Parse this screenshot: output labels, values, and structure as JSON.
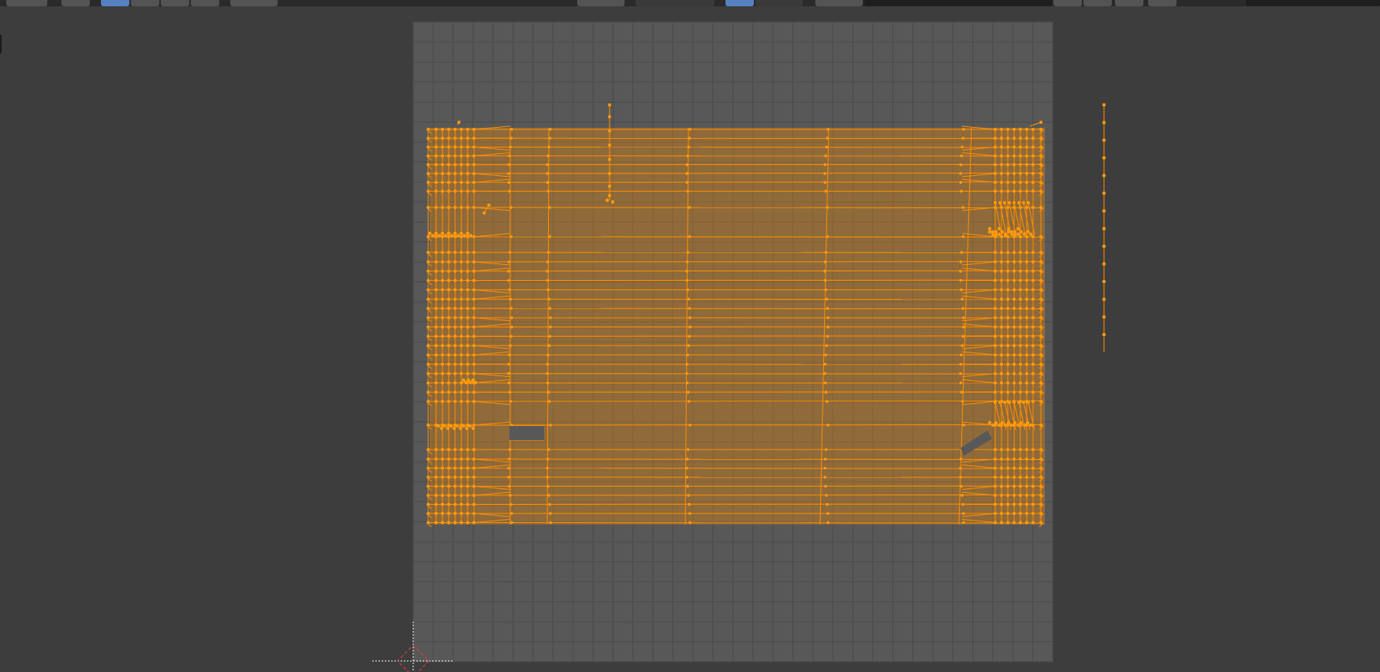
{
  "editor": "uv-editor",
  "colors": {
    "background": "#3d3d3d",
    "image_area": "#585858",
    "grid_line": "#4a4a4a",
    "mesh_edge": "#ff8f00",
    "mesh_vertex": "#ff9a0a",
    "mesh_fill": "#ff8f00",
    "cursor_red": "#d33f3f",
    "cursor_white": "#ffffff",
    "toolbar_active": "#5680c2"
  },
  "toolbar": {
    "icons": [
      "mode-icon",
      "pin-icon",
      "vertex-select-icon",
      "edge-select-icon",
      "face-select-icon",
      "island-select-icon",
      "sticky-select-icon",
      "view-icon",
      "sync-icon",
      "image-icon",
      "new-image-icon",
      "open-image-icon",
      "pivot-icon",
      "snap-icon",
      "proportional-icon"
    ]
  },
  "cursor": "2d-cursor"
}
